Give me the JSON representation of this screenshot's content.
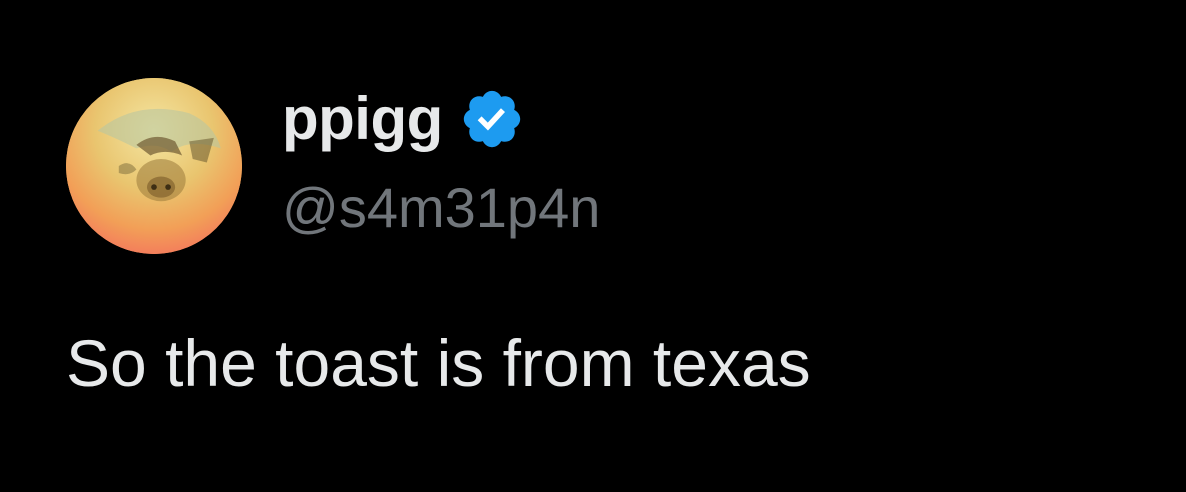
{
  "author": {
    "display_name": "ppigg",
    "handle": "@s4m31p4n",
    "avatar_icon": "avatar-image",
    "verified_icon": "verified-badge-icon"
  },
  "tweet": {
    "text": "So the toast is from texas"
  },
  "colors": {
    "background": "#000000",
    "primary_text": "#e7e9ea",
    "secondary_text": "#71767b",
    "verified_blue": "#1d9bf0"
  }
}
